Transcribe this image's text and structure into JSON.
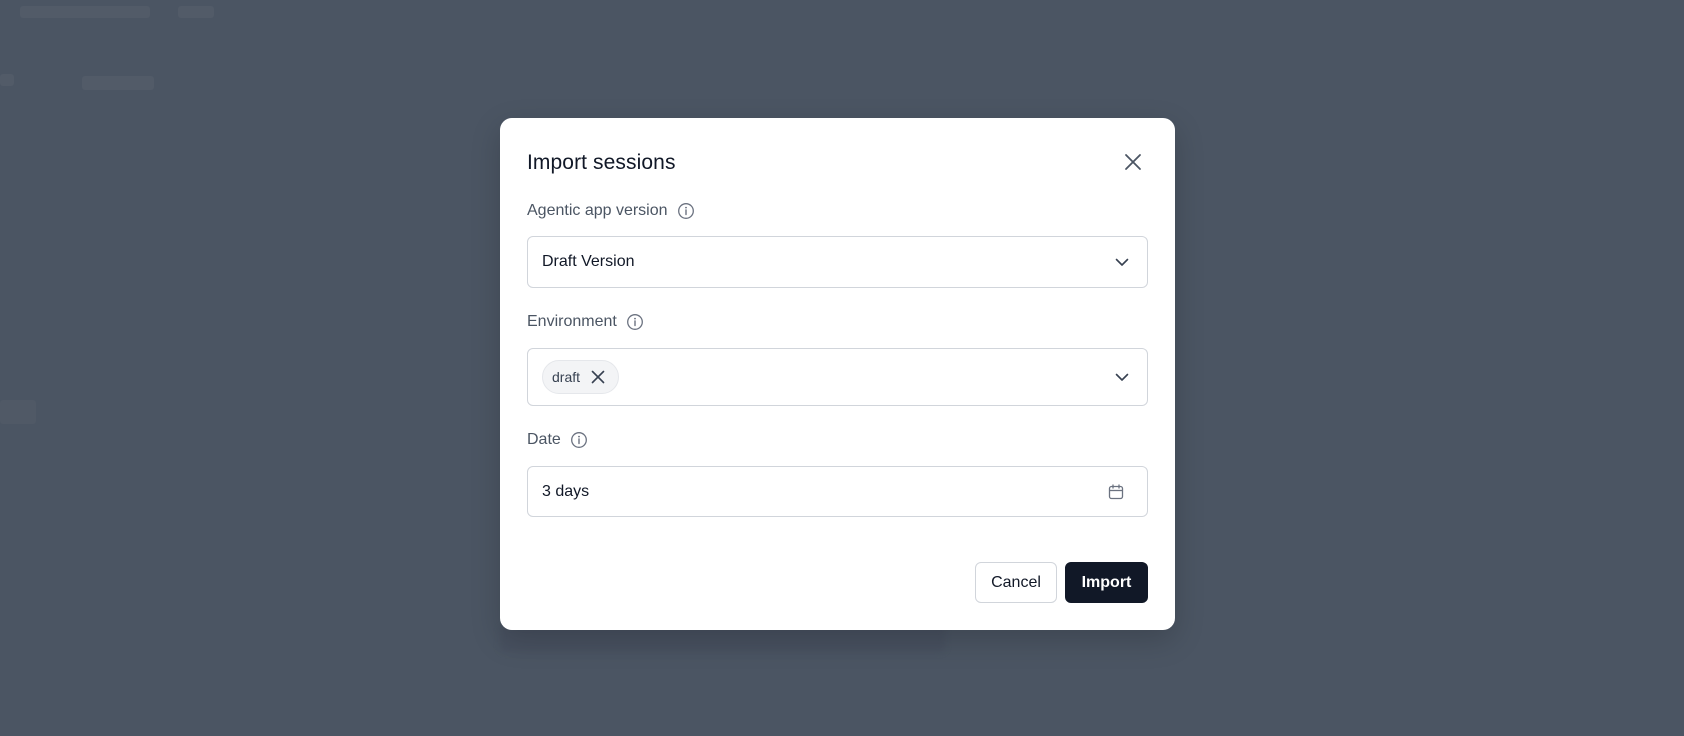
{
  "dialog": {
    "title": "Import sessions",
    "close_icon": "close-icon"
  },
  "fields": {
    "version": {
      "label": "Agentic app version",
      "value": "Draft Version",
      "info_icon": "info-icon"
    },
    "environment": {
      "label": "Environment",
      "chips": [
        "draft"
      ],
      "info_icon": "info-icon"
    },
    "date": {
      "label": "Date",
      "value": "3 days",
      "info_icon": "info-icon",
      "trailing_icon": "calendar-icon"
    }
  },
  "actions": {
    "cancel_label": "Cancel",
    "import_label": "Import"
  },
  "colors": {
    "overlay": "#4b5563",
    "primary_button": "#111827",
    "border": "#d1d5db"
  }
}
